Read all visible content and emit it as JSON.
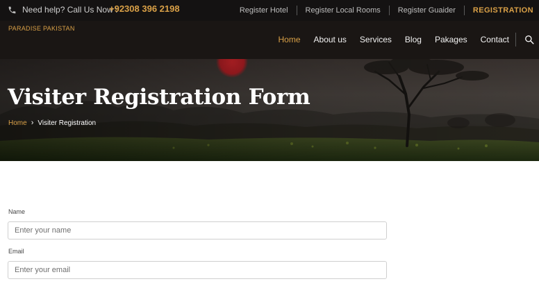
{
  "topbar": {
    "help_text": "Need help? Call Us Now :",
    "phone_number": "+92308 396 2198",
    "links": [
      "Register Hotel",
      "Register Local Rooms",
      "Register Guaider",
      "REGISTRATION"
    ]
  },
  "navbar": {
    "brand": "PARADISE PAKISTAN",
    "menu": [
      "Home",
      "About us",
      "Services",
      "Blog",
      "Pakages",
      "Contact"
    ],
    "active": "Home"
  },
  "hero": {
    "title": "Visiter Registration Form",
    "breadcrumb": {
      "home": "Home",
      "separator": "›",
      "current": "Visiter Registration"
    }
  },
  "form": {
    "name": {
      "label": "Name",
      "placeholder": "Enter your name",
      "value": ""
    },
    "email": {
      "label": "Email",
      "placeholder": "Enter your email",
      "value": ""
    }
  },
  "colors": {
    "accent": "#d9a047",
    "topbar_bg": "#141212",
    "navbar_bg": "#1a1614"
  }
}
